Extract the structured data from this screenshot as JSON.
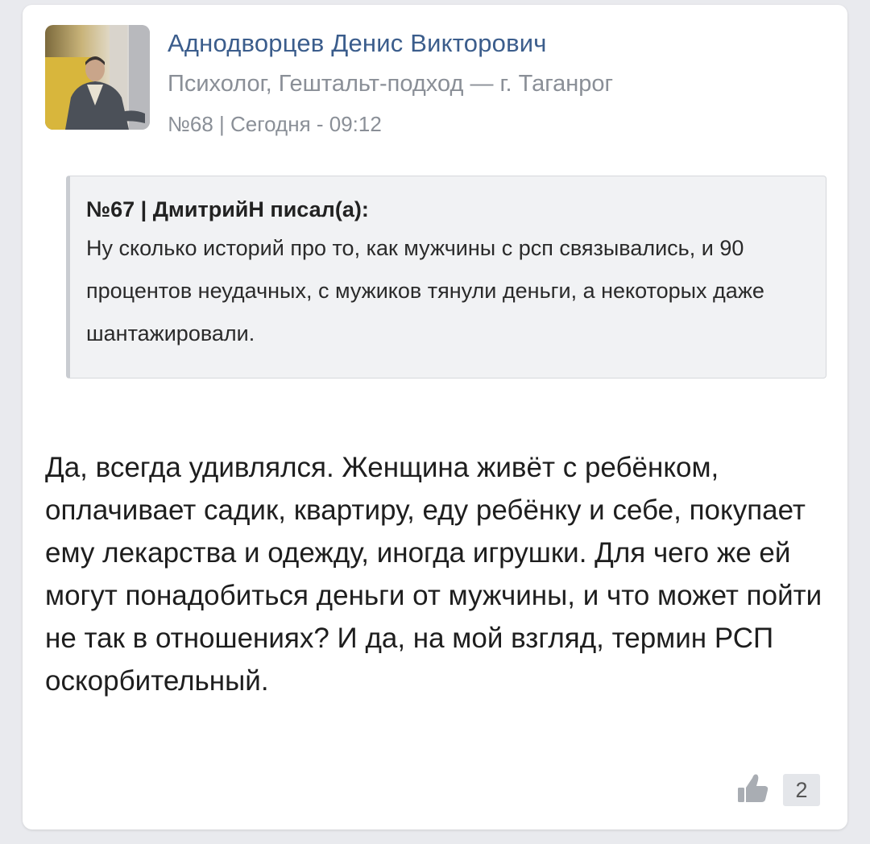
{
  "post": {
    "author_name": "Аднодворцев Денис Викторович",
    "author_role": "Психолог, Гештальт-подход — г. Таганрог",
    "meta": "№68 | Сегодня - 09:12",
    "quote": {
      "header": "№67 | ДмитрийН писал(а):",
      "text": "Ну сколько историй про то, как мужчины с рсп связывались, и 90 процентов неудачных, с мужиков тянули деньги, а некоторых даже шантажировали."
    },
    "body": "Да, всегда удивлялся. Женщина живёт с ребёнком, оплачивает садик, квартиру, еду ребёнку и себе, покупает ему лекарства и одежду, иногда игрушки. Для чего же ей могут понадобиться деньги от мужчины, и что может пойти не так в отношениях? И да, на мой взгляд, термин РСП оскорбительный.",
    "likes": "2"
  },
  "icons": {
    "like": "thumbs-up-icon",
    "avatar": "author-avatar-photo"
  },
  "colors": {
    "author_name": "#3b5d8c",
    "secondary_text": "#8a8f97",
    "quote_bg": "#f1f2f4",
    "page_bg": "#e9eaee"
  }
}
